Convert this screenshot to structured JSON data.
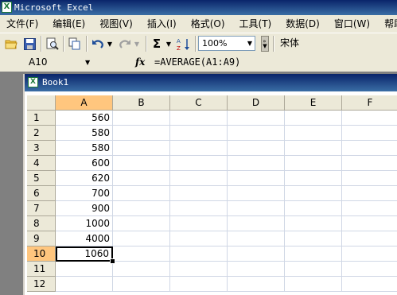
{
  "app": {
    "title": "Microsoft Excel",
    "icon": "excel-icon"
  },
  "menu": [
    "文件(F)",
    "编辑(E)",
    "视图(V)",
    "插入(I)",
    "格式(O)",
    "工具(T)",
    "数据(D)",
    "窗口(W)",
    "帮助"
  ],
  "toolbar": {
    "zoom": "100%",
    "font": "宋体",
    "sigma": "Σ"
  },
  "formula_bar": {
    "name_box": "A10",
    "fx": "fx",
    "formula": "=AVERAGE(A1:A9)"
  },
  "workbook": {
    "title": "Book1"
  },
  "grid": {
    "columns": [
      "A",
      "B",
      "C",
      "D",
      "E",
      "F"
    ],
    "rows": [
      "1",
      "2",
      "3",
      "4",
      "5",
      "6",
      "7",
      "8",
      "9",
      "10",
      "11",
      "12"
    ],
    "values_a": [
      "560",
      "580",
      "580",
      "600",
      "620",
      "700",
      "900",
      "1000",
      "4000",
      "1060",
      "",
      ""
    ],
    "selected_cell": "A10"
  }
}
